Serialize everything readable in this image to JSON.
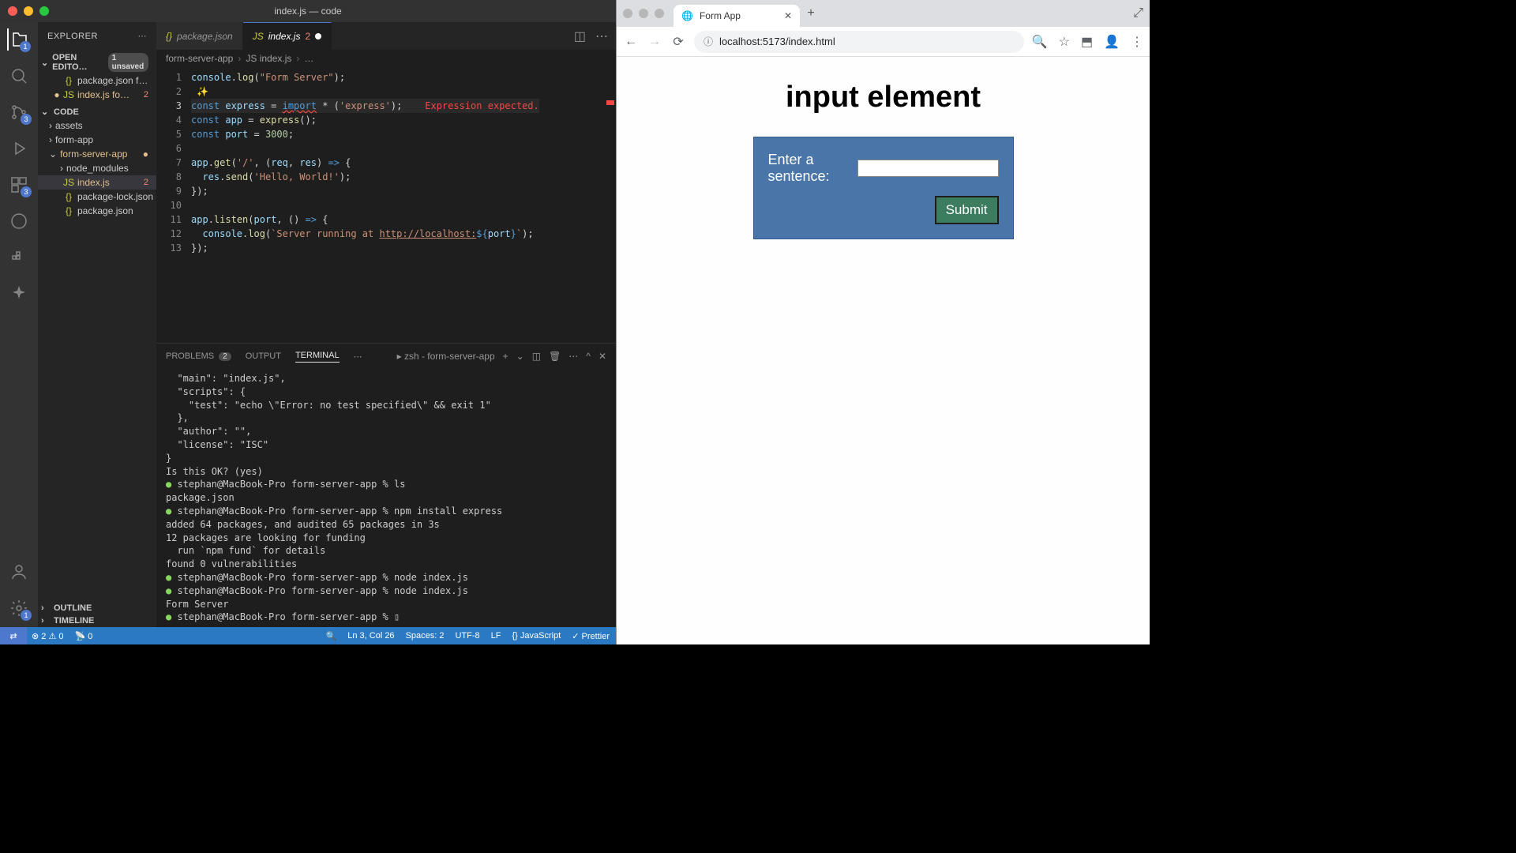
{
  "vscode": {
    "title": "index.js — code",
    "explorer": {
      "title": "EXPLORER",
      "openEditors": {
        "label": "OPEN EDITO…",
        "unsaved": "1 unsaved"
      },
      "openFiles": [
        {
          "icon": "{}",
          "name": "package.json",
          "suffix": "f…",
          "mod": false
        },
        {
          "icon": "JS",
          "name": "index.js",
          "suffix": "fo…",
          "err": "2",
          "mod": true
        }
      ],
      "codeLabel": "CODE",
      "tree": [
        {
          "type": "folder",
          "name": "assets",
          "depth": 1
        },
        {
          "type": "folder",
          "name": "form-app",
          "depth": 1
        },
        {
          "type": "folder",
          "name": "form-server-app",
          "depth": 1,
          "mod": true,
          "expanded": true
        },
        {
          "type": "folder",
          "name": "node_modules",
          "depth": 2
        },
        {
          "type": "file",
          "icon": "JS",
          "name": "index.js",
          "depth": 2,
          "sel": true,
          "mod": true,
          "err": "2"
        },
        {
          "type": "file",
          "icon": "{}",
          "name": "package-lock.json",
          "depth": 2
        },
        {
          "type": "file",
          "icon": "{}",
          "name": "package.json",
          "depth": 2
        }
      ],
      "outline": "OUTLINE",
      "timeline": "TIMELINE"
    },
    "tabs": [
      {
        "icon": "{}",
        "label": "package.json",
        "active": false
      },
      {
        "icon": "JS",
        "label": "index.js",
        "err": "2",
        "active": true,
        "dirty": true
      }
    ],
    "breadcrumbs": [
      "form-server-app",
      "JS index.js",
      "…"
    ],
    "code": {
      "lines": [
        {
          "n": 1,
          "seg": [
            {
              "t": "console",
              "c": "var"
            },
            {
              "t": ".",
              "c": "op"
            },
            {
              "t": "log",
              "c": "fn"
            },
            {
              "t": "(",
              "c": "op"
            },
            {
              "t": "\"Form Server\"",
              "c": "str"
            },
            {
              "t": ");",
              "c": "op"
            }
          ]
        },
        {
          "n": 2,
          "seg": [
            {
              "t": " ✨",
              "c": "op"
            }
          ]
        },
        {
          "n": 3,
          "hl": true,
          "seg": [
            {
              "t": "const ",
              "c": "kw"
            },
            {
              "t": "express ",
              "c": "var"
            },
            {
              "t": "= ",
              "c": "op"
            },
            {
              "t": "import",
              "c": "kw errline"
            },
            {
              "t": " * (",
              "c": "op"
            },
            {
              "t": "'express'",
              "c": "str"
            },
            {
              "t": ");",
              "c": "op"
            },
            {
              "t": "    Expression expected.",
              "c": "err"
            }
          ]
        },
        {
          "n": 4,
          "seg": [
            {
              "t": "const ",
              "c": "kw"
            },
            {
              "t": "app ",
              "c": "var"
            },
            {
              "t": "= ",
              "c": "op"
            },
            {
              "t": "express",
              "c": "fn"
            },
            {
              "t": "();",
              "c": "op"
            }
          ]
        },
        {
          "n": 5,
          "seg": [
            {
              "t": "const ",
              "c": "kw"
            },
            {
              "t": "port ",
              "c": "var"
            },
            {
              "t": "= ",
              "c": "op"
            },
            {
              "t": "3000",
              "c": "num"
            },
            {
              "t": ";",
              "c": "op"
            }
          ]
        },
        {
          "n": 6,
          "seg": [
            {
              "t": "",
              "c": "op"
            }
          ]
        },
        {
          "n": 7,
          "seg": [
            {
              "t": "app",
              "c": "var"
            },
            {
              "t": ".",
              "c": "op"
            },
            {
              "t": "get",
              "c": "fn"
            },
            {
              "t": "(",
              "c": "op"
            },
            {
              "t": "'/'",
              "c": "str"
            },
            {
              "t": ", (",
              "c": "op"
            },
            {
              "t": "req",
              "c": "var"
            },
            {
              "t": ", ",
              "c": "op"
            },
            {
              "t": "res",
              "c": "var"
            },
            {
              "t": ") ",
              "c": "op"
            },
            {
              "t": "=>",
              "c": "kw"
            },
            {
              "t": " {",
              "c": "op"
            }
          ]
        },
        {
          "n": 8,
          "seg": [
            {
              "t": "  res",
              "c": "var"
            },
            {
              "t": ".",
              "c": "op"
            },
            {
              "t": "send",
              "c": "fn"
            },
            {
              "t": "(",
              "c": "op"
            },
            {
              "t": "'Hello, World!'",
              "c": "str"
            },
            {
              "t": ");",
              "c": "op"
            }
          ]
        },
        {
          "n": 9,
          "seg": [
            {
              "t": "});",
              "c": "op"
            }
          ]
        },
        {
          "n": 10,
          "seg": [
            {
              "t": "",
              "c": "op"
            }
          ]
        },
        {
          "n": 11,
          "seg": [
            {
              "t": "app",
              "c": "var"
            },
            {
              "t": ".",
              "c": "op"
            },
            {
              "t": "listen",
              "c": "fn"
            },
            {
              "t": "(",
              "c": "op"
            },
            {
              "t": "port",
              "c": "var"
            },
            {
              "t": ", () ",
              "c": "op"
            },
            {
              "t": "=>",
              "c": "kw"
            },
            {
              "t": " {",
              "c": "op"
            }
          ]
        },
        {
          "n": 12,
          "seg": [
            {
              "t": "  console",
              "c": "var"
            },
            {
              "t": ".",
              "c": "op"
            },
            {
              "t": "log",
              "c": "fn"
            },
            {
              "t": "(",
              "c": "op"
            },
            {
              "t": "`Server running at ",
              "c": "str"
            },
            {
              "t": "http://localhost:",
              "c": "link"
            },
            {
              "t": "${",
              "c": "kw"
            },
            {
              "t": "port",
              "c": "var"
            },
            {
              "t": "}",
              "c": "kw"
            },
            {
              "t": "`",
              "c": "str"
            },
            {
              "t": ");",
              "c": "op"
            }
          ]
        },
        {
          "n": 13,
          "seg": [
            {
              "t": "});",
              "c": "op"
            }
          ]
        }
      ]
    },
    "panel": {
      "tabs": {
        "problems": "PROBLEMS",
        "problemsCount": "2",
        "output": "OUTPUT",
        "terminal": "TERMINAL"
      },
      "shell": "zsh - form-server-app",
      "lines": [
        "  \"main\": \"index.js\",",
        "  \"scripts\": {",
        "    \"test\": \"echo \\\"Error: no test specified\\\" && exit 1\"",
        "  },",
        "  \"author\": \"\",",
        "  \"license\": \"ISC\"",
        "}",
        "",
        "Is this OK? (yes)",
        "● stephan@MacBook-Pro form-server-app % ls",
        "package.json",
        "● stephan@MacBook-Pro form-server-app % npm install express",
        "",
        "added 64 packages, and audited 65 packages in 3s",
        "",
        "12 packages are looking for funding",
        "  run `npm fund` for details",
        "",
        "found 0 vulnerabilities",
        "● stephan@MacBook-Pro form-server-app % node index.js",
        "● stephan@MacBook-Pro form-server-app % node index.js",
        "Form Server",
        "● stephan@MacBook-Pro form-server-app % ▯"
      ]
    },
    "status": {
      "errors": "2",
      "warnings": "0",
      "ports": "0",
      "cursor": "Ln 3, Col 26",
      "spaces": "Spaces: 2",
      "enc": "UTF-8",
      "eol": "LF",
      "lang": "{} JavaScript",
      "prettier": "✓ Prettier"
    },
    "activityBadges": {
      "explorer": "1",
      "scm": "3",
      "ext": "3",
      "settings": "1"
    }
  },
  "browser": {
    "tabTitle": "Form App",
    "url": "localhost:5173/index.html",
    "page": {
      "heading": "input element",
      "label": "Enter a sentence:",
      "submit": "Submit"
    }
  }
}
